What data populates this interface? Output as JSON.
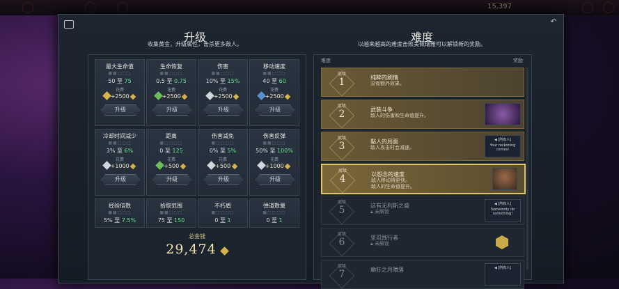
{
  "topbar": {
    "gold_amount": "15,397"
  },
  "upgrade": {
    "title": "升级",
    "subtitle": "收集黄金，升级属性，击杀更多敌人。",
    "cards": [
      {
        "name": "最大生命值",
        "from": "50",
        "sep": "至",
        "to": "75",
        "cost_label": "花费",
        "cost": "+2500",
        "gem": "gold",
        "button": "升级",
        "pips": "■■□□□"
      },
      {
        "name": "生命恢复",
        "from": "0.5",
        "sep": "至",
        "to": "0.75",
        "cost_label": "花费",
        "cost": "+2500",
        "gem": "green",
        "button": "升级",
        "pips": "■■□□□"
      },
      {
        "name": "伤害",
        "from": "10%",
        "sep": "至",
        "to": "15%",
        "cost_label": "花费",
        "cost": "+2500",
        "gem": "white",
        "button": "升级",
        "pips": "■■□□□"
      },
      {
        "name": "移动速度",
        "from": "40",
        "sep": "至",
        "to": "60",
        "cost_label": "花费",
        "cost": "+2500",
        "gem": "blue",
        "button": "升级",
        "pips": "■■□□□"
      },
      {
        "name": "冷却时间减少",
        "from": "3%",
        "sep": "至",
        "to": "6%",
        "cost_label": "花费",
        "cost": "+1000",
        "gem": "white",
        "button": "升级",
        "pips": "■■□□□"
      },
      {
        "name": "距离",
        "from": "0",
        "sep": "至",
        "to": "125",
        "cost_label": "花费",
        "cost": "+500",
        "gem": "green",
        "button": "升级",
        "pips": "■□□□□"
      },
      {
        "name": "伤害减免",
        "from": "0%",
        "sep": "至",
        "to": "5%",
        "cost_label": "花费",
        "cost": "+500",
        "gem": "white",
        "button": "升级",
        "pips": "■□□□□"
      },
      {
        "name": "伤害反弹",
        "from": "50%",
        "sep": "至",
        "to": "100%",
        "cost_label": "花费",
        "cost": "+1000",
        "gem": "white",
        "button": "升级",
        "pips": "■■□□□"
      },
      {
        "name": "经验倍数",
        "from": "5%",
        "sep": "至",
        "to": "7.5%",
        "pips": "■■□□□"
      },
      {
        "name": "拾取范围",
        "from": "75",
        "sep": "至",
        "to": "150",
        "pips": "■■□□□"
      },
      {
        "name": "不朽盾",
        "from": "0",
        "sep": "至",
        "to": "1",
        "pips": "■□□□□"
      },
      {
        "name": "弹道数量",
        "from": "0",
        "sep": "至",
        "to": "1",
        "pips": "■□□□□"
      }
    ],
    "total_label": "总金钱",
    "total_value": "29,474"
  },
  "difficulty": {
    "title": "难度",
    "subtitle": "以越来越高的难度击败美佩瑞雅可以解锁新的奖励。",
    "col_left": "难度",
    "col_right": "奖励",
    "level_label": "层级",
    "rows": [
      {
        "num": "1",
        "title": "纯粹的刷情",
        "desc": "没有额外效果。",
        "state": "done"
      },
      {
        "num": "2",
        "title": "武装斗争",
        "desc": "敌人的伤害和生命值提升。",
        "state": "done"
      },
      {
        "num": "3",
        "title": "黏人的局面",
        "desc": "敌人攻击时会减速。",
        "state": "done",
        "reward_tag": "[所有人]",
        "reward_text": "Your reckoning comes!"
      },
      {
        "num": "4",
        "title": "以怨念的速度",
        "desc": "敌人移动得更快。",
        "desc2": "敌人的生命值提升。",
        "state": "active"
      },
      {
        "num": "5",
        "title": "这有无利斯之盛",
        "desc": "未解锁",
        "state": "locked",
        "reward_tag": "[所有人]",
        "reward_text": "Somebody do something!"
      },
      {
        "num": "6",
        "title": "坚忍践行者",
        "desc": "未解锁",
        "state": "locked"
      },
      {
        "num": "7",
        "title": "癫狂之月隕落",
        "desc": "",
        "state": "locked",
        "reward_tag": "[所有人]"
      }
    ]
  },
  "colors": {
    "accent_gold": "#e0c664",
    "upgrade_green": "#66e08a"
  }
}
